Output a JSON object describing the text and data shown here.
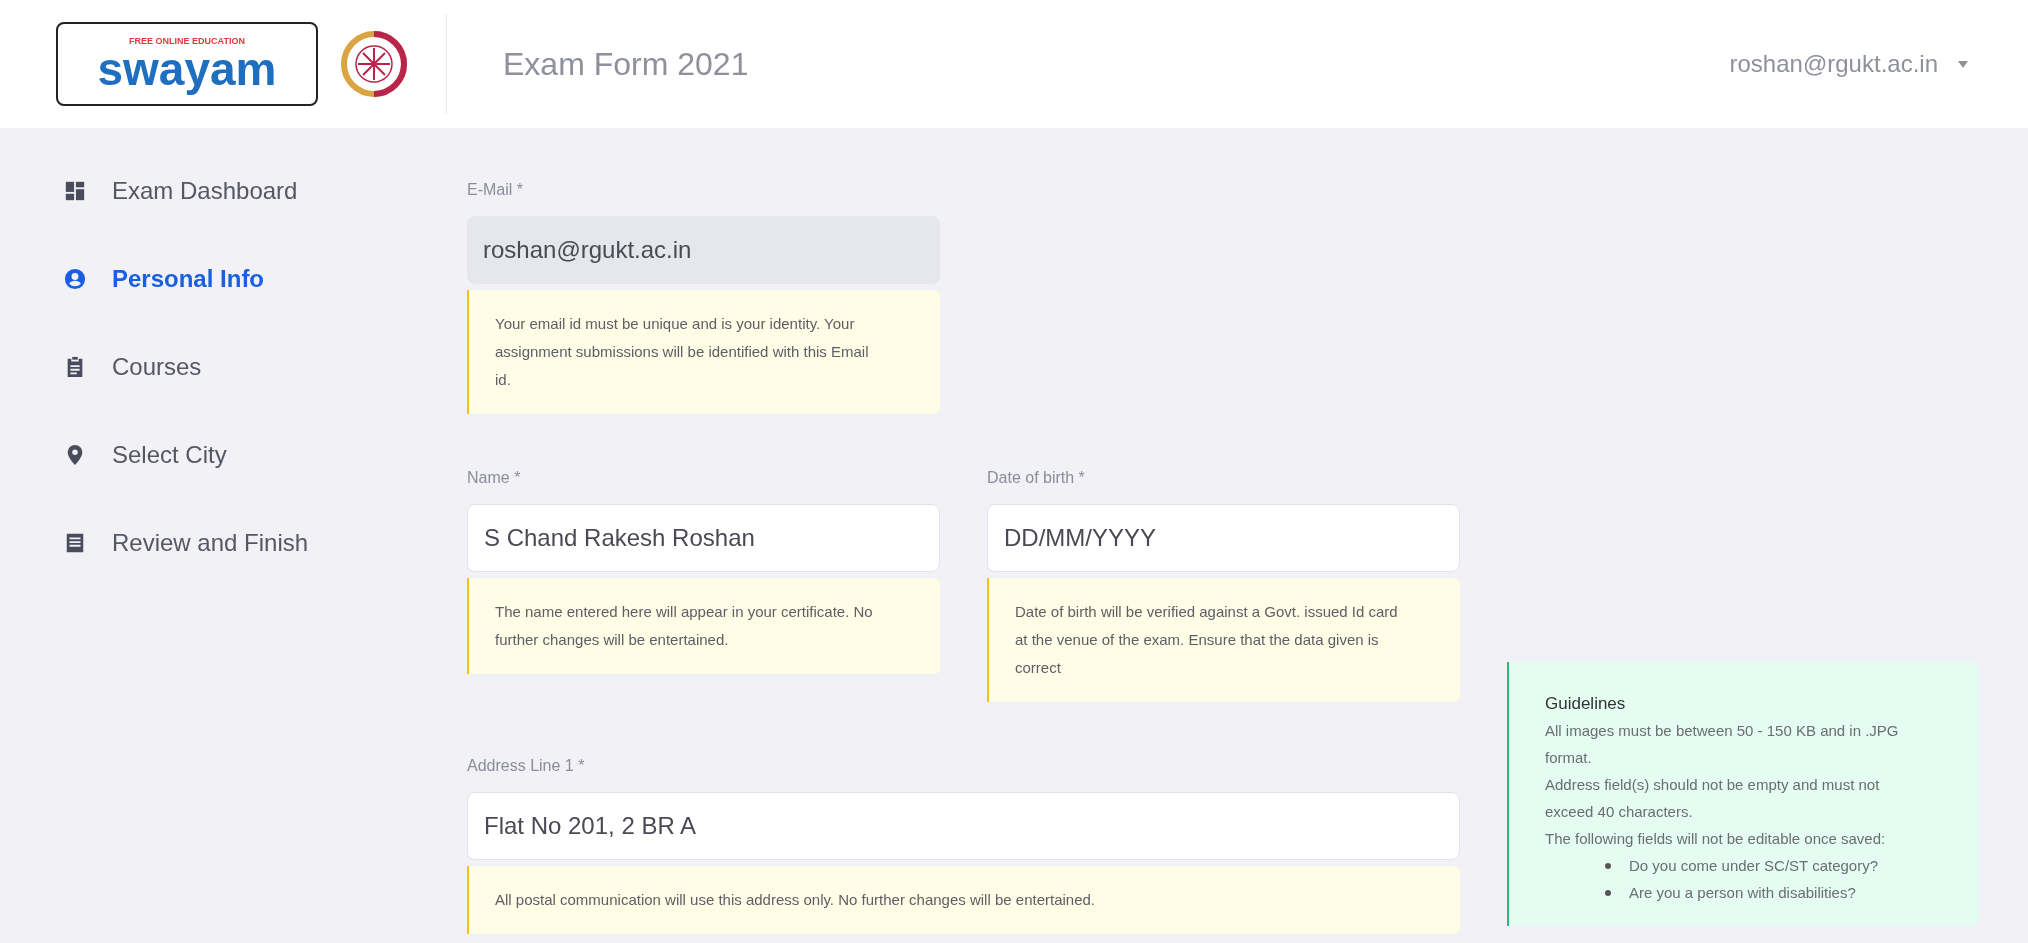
{
  "header": {
    "logo": {
      "tagline": "FREE ONLINE EDUCATION",
      "name": "swayam"
    },
    "title": "Exam Form 2021",
    "user": "roshan@rgukt.ac.in"
  },
  "sidebar": {
    "items": [
      {
        "kind": "dashboard",
        "label": "Exam Dashboard",
        "selected": false
      },
      {
        "kind": "person",
        "label": "Personal Info",
        "selected": true
      },
      {
        "kind": "clipboard",
        "label": "Courses",
        "selected": false
      },
      {
        "kind": "pin",
        "label": "Select City",
        "selected": false
      },
      {
        "kind": "list",
        "label": "Review and Finish",
        "selected": false
      }
    ]
  },
  "form": {
    "rows": [
      [
        {
          "label": "E-Mail *",
          "value": "roshan@rgukt.ac.in",
          "disabled": true,
          "wide": false,
          "hint": "Your email id must be unique and is your identity. Your assignment submissions will be identified with this Email id."
        }
      ],
      [
        {
          "label": "Name *",
          "value": "S Chand Rakesh Roshan",
          "disabled": false,
          "wide": false,
          "hint": "The name entered here will appear in your certificate. No further changes will be entertained."
        },
        {
          "label": "Date of birth *",
          "placeholder": "DD/MM/YYYY",
          "disabled": false,
          "wide": false,
          "hint": "Date of birth will be verified against a Govt. issued Id card at the venue of the exam. Ensure that the data given is correct"
        }
      ],
      [
        {
          "label": "Address Line 1 *",
          "value": "Flat No 201, 2 BR A",
          "disabled": false,
          "wide": true,
          "hint": "All postal communication will use this address only. No further changes will be entertained."
        }
      ]
    ]
  },
  "guidelines": {
    "title": "Guidelines",
    "paragraphs": [
      "All images must be between 50 - 150 KB and in .JPG format.",
      "Address field(s) should not be empty and must not exceed 40 characters.",
      "The following fields will not be editable once saved:"
    ],
    "bullets": [
      "Do you come under SC/ST category?",
      "Are you a person with disabilities?"
    ]
  }
}
